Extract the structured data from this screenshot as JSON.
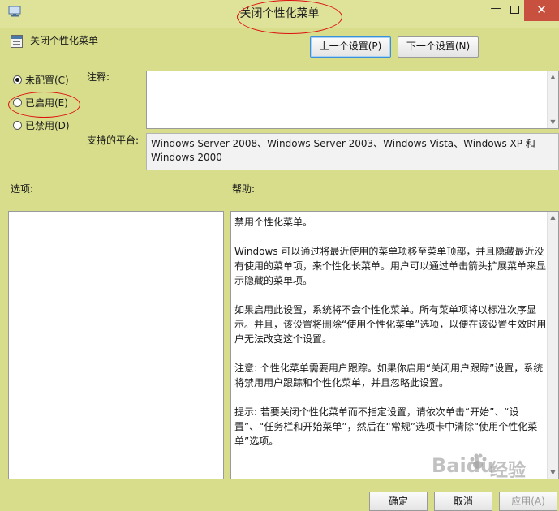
{
  "window": {
    "title": "关闭个性化菜单",
    "controls": {
      "minimize": "—",
      "maximize": "",
      "close": "✕"
    },
    "icon": "gpedit-window-icon"
  },
  "header": {
    "policy_title": "关闭个性化菜单",
    "policy_icon": "policy-setting-icon",
    "prev_button": "上一个设置(P)",
    "next_button": "下一个设置(N)"
  },
  "state_options": [
    {
      "label": "未配置(C)",
      "selected": true
    },
    {
      "label": "已启用(E)",
      "selected": false
    },
    {
      "label": "已禁用(D)",
      "selected": false
    }
  ],
  "comment": {
    "label": "注释:",
    "value": ""
  },
  "platform": {
    "label": "支持的平台:",
    "value": "Windows Server 2008、Windows Server 2003、Windows Vista、Windows XP 和 Windows 2000"
  },
  "options": {
    "label": "选项:"
  },
  "help": {
    "label": "帮助:",
    "paragraphs": [
      "禁用个性化菜单。",
      "Windows 可以通过将最近使用的菜单项移至菜单顶部，并且隐藏最近没有使用的菜单项，来个性化长菜单。用户可以通过单击箭头扩展菜单来显示隐藏的菜单项。",
      "如果启用此设置，系统将不会个性化菜单。所有菜单项将以标准次序显示。并且，该设置将删除“使用个性化菜单”选项，以便在该设置生效时用户无法改变这个设置。",
      "注意: 个性化菜单需要用户跟踪。如果你启用“关闭用户跟踪”设置，系统将禁用用户跟踪和个性化菜单，并且忽略此设置。",
      "提示: 若要关闭个性化菜单而不指定设置，请依次单击“开始”、“设置”、“任务栏和开始菜单”，然后在“常规”选项卡中清除“使用个性化菜单”选项。"
    ]
  },
  "footer": {
    "ok": "确定",
    "cancel": "取消",
    "apply": "应用(A)"
  },
  "watermark": {
    "brand": "Baidu",
    "suffix": "经验"
  },
  "colors": {
    "window_bg": "#d7dd8b",
    "annotation_red": "#d11111",
    "close_button": "#c7503f"
  }
}
